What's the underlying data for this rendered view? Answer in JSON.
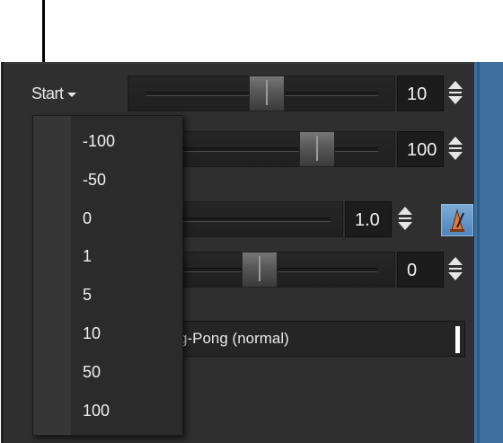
{
  "start_menu": {
    "label": "Start"
  },
  "rows": [
    {
      "value": "10",
      "thumb_fraction": 0.55
    },
    {
      "value": "100",
      "thumb_fraction": 0.85
    },
    {
      "value": "1.0"
    },
    {
      "value": "0",
      "thumb_fraction": 0.5
    }
  ],
  "loop_mode": {
    "value": "g-Pong (normal)"
  },
  "dropdown": {
    "options": [
      "-100",
      "-50",
      "0",
      "1",
      "5",
      "10",
      "50",
      "100"
    ]
  },
  "icons": {
    "spinner": "up-down-spinner-icon",
    "metronome": "metronome-icon",
    "dropdown_caret": "chevron-down-icon"
  },
  "colors": {
    "panel": "#2f2f2f",
    "dropdown": "#2b2b2b",
    "accent_blue": "#4f86bd",
    "text": "#f0f0f0"
  }
}
